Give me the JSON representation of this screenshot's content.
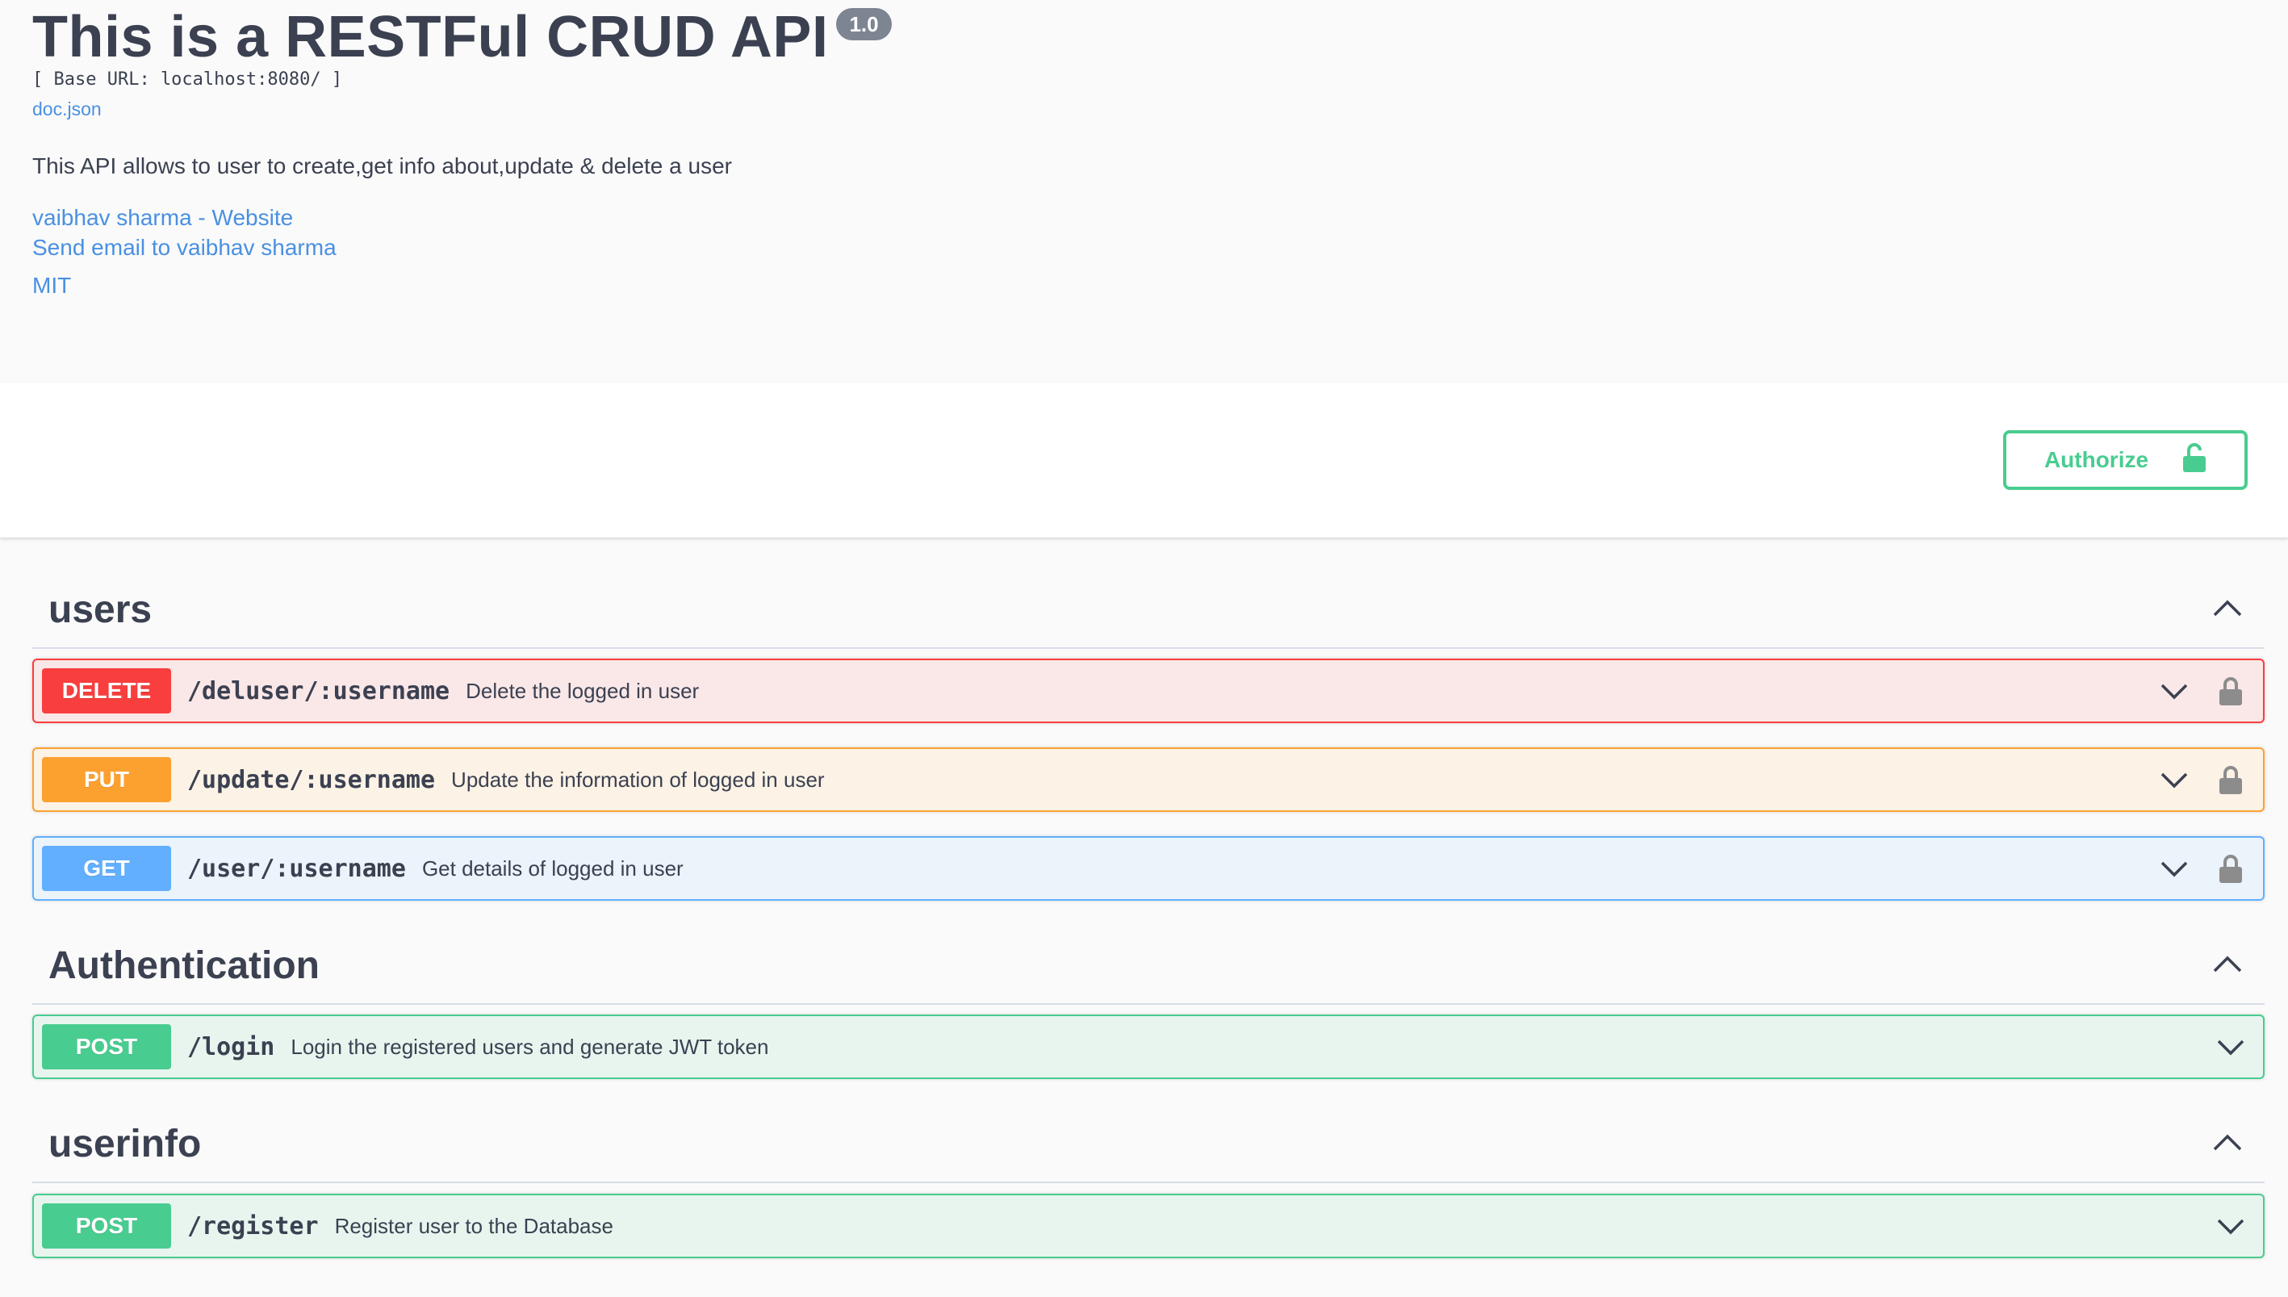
{
  "info": {
    "title": "This is a RESTFul CRUD API",
    "version": "1.0",
    "base_url": "[ Base URL: localhost:8080/ ]",
    "doc_link": "doc.json",
    "description": "This API allows to user to create,get info about,update & delete a user",
    "contact_website": "vaibhav sharma - Website",
    "contact_email": "Send email to vaibhav sharma",
    "license": "MIT"
  },
  "auth": {
    "authorize_label": "Authorize",
    "icon": "unlock-icon"
  },
  "tags": [
    {
      "name": "users",
      "operations": [
        {
          "method": "DELETE",
          "path": "/deluser/:username",
          "summary": "Delete the logged in user",
          "locked": true
        },
        {
          "method": "PUT",
          "path": "/update/:username",
          "summary": "Update the information of logged in user",
          "locked": true
        },
        {
          "method": "GET",
          "path": "/user/:username",
          "summary": "Get details of logged in user",
          "locked": true
        }
      ]
    },
    {
      "name": "Authentication",
      "operations": [
        {
          "method": "POST",
          "path": "/login",
          "summary": "Login the registered users and generate JWT token",
          "locked": false
        }
      ]
    },
    {
      "name": "userinfo",
      "operations": [
        {
          "method": "POST",
          "path": "/register",
          "summary": "Register user to the Database",
          "locked": false
        }
      ]
    }
  ],
  "colors": {
    "delete": "#f93e3e",
    "put": "#fca130",
    "get": "#61affe",
    "post": "#49cc90",
    "link": "#4990e2",
    "text": "#3b4151"
  }
}
